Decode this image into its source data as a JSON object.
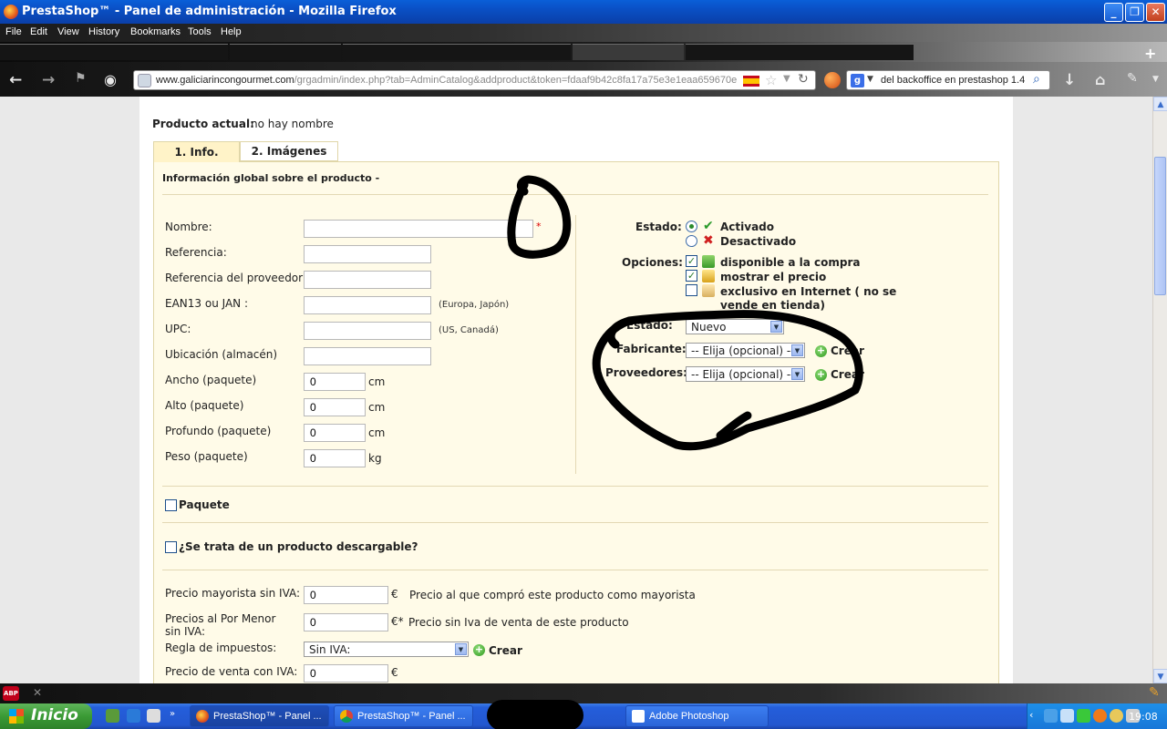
{
  "window": {
    "title": "PrestaShop™ - Panel de administración - Mozilla Firefox"
  },
  "menu": [
    "File",
    "Edit",
    "View",
    "History",
    "Bookmarks",
    "Tools",
    "Help"
  ],
  "navbar": {
    "url_host": "www.galiciarincongourmet.com",
    "url_path": "/grgadmin/index.php?tab=AdminCatalog&addproduct&token=fdaaf9b42c8fa17a75e3e1eaa659670e",
    "search_text": "del backoffice en prestashop 1.4"
  },
  "page": {
    "current_product_label": "Producto actual:",
    "current_product_value": "no hay nombre",
    "tabs": [
      "1. Info.",
      "2. Imágenes (0)"
    ],
    "section_title": "Información global sobre el producto -",
    "fields": {
      "nombre": "Nombre:",
      "referencia": "Referencia:",
      "ref_proveedor": "Referencia del proveedor:",
      "ean": "EAN13 ou JAN :",
      "ean_hint": "(Europa, Japón)",
      "upc": "UPC:",
      "upc_hint": "(US, Canadá)",
      "ubicacion": "Ubicación (almacén)",
      "ancho": "Ancho (paquete)",
      "alto": "Alto (paquete)",
      "profundo": "Profundo (paquete)",
      "peso": "Peso (paquete)",
      "required_mark": "*"
    },
    "dimension_values": {
      "ancho": "0",
      "alto": "0",
      "profundo": "0",
      "peso": "0"
    },
    "units": {
      "cm": "cm",
      "kg": "kg"
    },
    "estado": {
      "label": "Estado:",
      "activado": "Activado",
      "desactivado": "Desactivado"
    },
    "opciones": {
      "label": "Opciones:",
      "disponible": "disponible a la compra",
      "mostrar": "mostrar el precio",
      "exclusivo": "exclusivo en Internet ( no se vende en tienda)"
    },
    "estado_select": {
      "label": "Estado:",
      "value": "Nuevo"
    },
    "fabricante": {
      "label": "Fabricante:",
      "value": "-- Elija (opcional) --",
      "create": "Crear"
    },
    "proveedores": {
      "label": "Proveedores:",
      "value": "-- Elija (opcional) --",
      "create": "Crear"
    },
    "paquete": "Paquete",
    "descargable": "¿Se trata de un producto descargable?",
    "pricing": {
      "mayorista_label": "Precio mayorista sin IVA:",
      "mayorista_value": "0",
      "mayorista_hint": "Precio al que compró este producto como mayorista",
      "menor_label": "Precios al Por Menor sin IVA:",
      "menor_value": "0",
      "menor_hint": "Precio sin Iva de venta de este producto",
      "impuestos_label": "Regla de impuestos:",
      "impuestos_value": "Sin IVA:",
      "impuestos_create": "Crear",
      "venta_label": "Precio de venta con IVA:",
      "venta_value": "0",
      "currency": "€",
      "currency_req": "€*"
    }
  },
  "taskbar": {
    "start": "Inicio",
    "items": [
      "PrestaShop™ - Panel ...",
      "PrestaShop™ - Panel ...",
      "Adobe Photoshop"
    ],
    "clock": "19:08"
  },
  "colors": {
    "accent": "#0a4fc4",
    "panel_bg": "#fffbe8",
    "tab_active": "#fff3c8"
  }
}
